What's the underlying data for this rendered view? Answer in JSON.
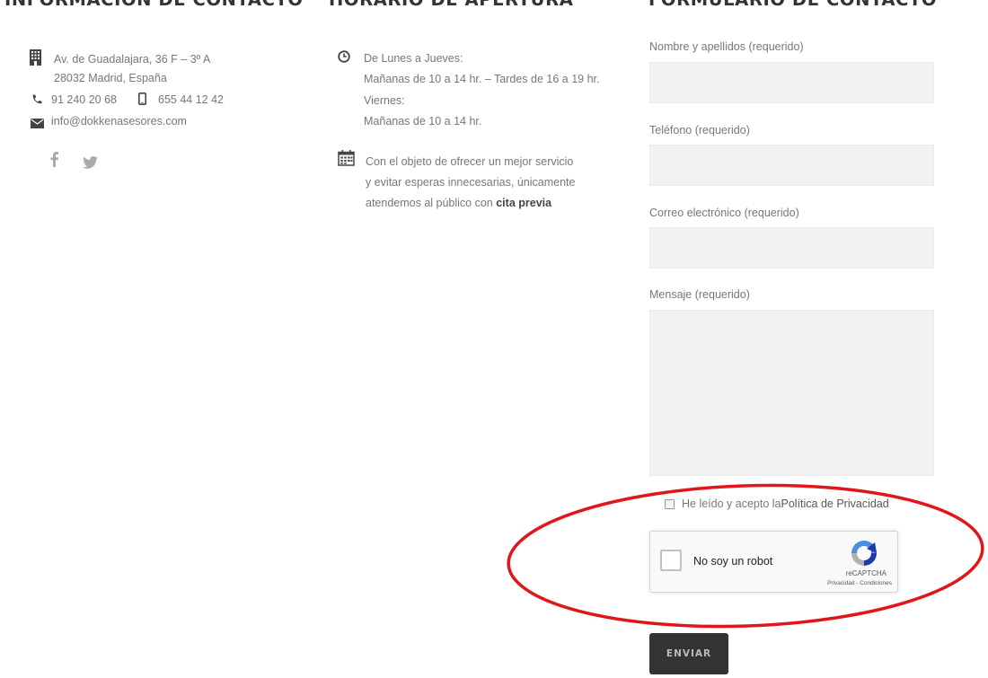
{
  "headings": {
    "info": "INFORMACIÓN DE CONTACTO",
    "hours": "HORARIO DE APERTURA",
    "form": "FORMULARIO DE CONTACTO"
  },
  "contact": {
    "address_line1": "Av. de Guadalajara, 36 F – 3º A",
    "address_line2": "28032 Madrid, España",
    "phone": "91 240 20 68",
    "mobile": "655 44 12 42",
    "email": "info@dokkenasesores.com",
    "social": [
      "facebook-icon",
      "twitter-icon"
    ]
  },
  "hours": {
    "line1": "De Lunes a Jueves:",
    "line2": "Mañanas de 10 a 14 hr. – Tardes de 16 a 19 hr.",
    "line3": "Viernes:",
    "line4": "Mañanas de 10 a 14 hr.",
    "note1": "Con el objeto de ofrecer un mejor servicio",
    "note2": "y evitar esperas innecesarias, únicamente",
    "note3_prefix": "atendemos al público con ",
    "note3_bold": "cita previa"
  },
  "form": {
    "name_label": "Nombre y apellidos (requerido)",
    "phone_label": "Teléfono (requerido)",
    "email_label": "Correo electrónico (requerido)",
    "message_label": "Mensaje (requerido)",
    "name_value": "",
    "phone_value": "",
    "email_value": "",
    "message_value": "",
    "privacy_prefix": "He leído y acepto la ",
    "privacy_link": "Política de Privacidad",
    "privacy_checked": false,
    "submit_label": "ENVIAR"
  },
  "captcha": {
    "label": "No soy un robot",
    "brand": "reCAPTCHA",
    "terms": "Privacidad - Condiciones",
    "checked": false
  },
  "colors": {
    "heading": "#333333",
    "text": "#777777",
    "field_bg": "#f2f2f2",
    "button_bg": "#333333",
    "highlight_ellipse": "#e0161b"
  }
}
